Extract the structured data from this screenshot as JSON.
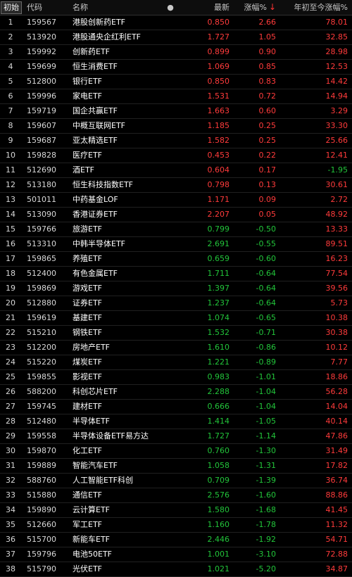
{
  "header": {
    "reset_label": "初始",
    "code_label": "代码",
    "name_label": "名称",
    "dot_icon": "●",
    "price_label": "最新",
    "change_label": "涨幅%",
    "sort_icon": "↓",
    "ytd_label": "年初至今涨幅%"
  },
  "colors": {
    "up": "#ff3b3b",
    "down": "#22c53a",
    "background": "#000000"
  },
  "rows": [
    {
      "idx": "1",
      "code": "159567",
      "name": "港股创新药ETF",
      "price": "0.850",
      "chg": "2.66",
      "ytd": "78.01"
    },
    {
      "idx": "2",
      "code": "513920",
      "name": "港股通央企红利ETF",
      "price": "1.727",
      "chg": "1.05",
      "ytd": "32.85"
    },
    {
      "idx": "3",
      "code": "159992",
      "name": "创新药ETF",
      "price": "0.899",
      "chg": "0.90",
      "ytd": "28.98"
    },
    {
      "idx": "4",
      "code": "159699",
      "name": "恒生消费ETF",
      "price": "1.069",
      "chg": "0.85",
      "ytd": "12.53"
    },
    {
      "idx": "5",
      "code": "512800",
      "name": "银行ETF",
      "price": "0.850",
      "chg": "0.83",
      "ytd": "14.42"
    },
    {
      "idx": "6",
      "code": "159996",
      "name": "家电ETF",
      "price": "1.531",
      "chg": "0.72",
      "ytd": "14.94"
    },
    {
      "idx": "7",
      "code": "159719",
      "name": "国企共赢ETF",
      "price": "1.663",
      "chg": "0.60",
      "ytd": "3.29"
    },
    {
      "idx": "8",
      "code": "159607",
      "name": "中概互联网ETF",
      "price": "1.185",
      "chg": "0.25",
      "ytd": "33.30"
    },
    {
      "idx": "9",
      "code": "159687",
      "name": "亚太精选ETF",
      "price": "1.582",
      "chg": "0.25",
      "ytd": "25.66"
    },
    {
      "idx": "10",
      "code": "159828",
      "name": "医疗ETF",
      "price": "0.453",
      "chg": "0.22",
      "ytd": "12.41"
    },
    {
      "idx": "11",
      "code": "512690",
      "name": "酒ETF",
      "price": "0.604",
      "chg": "0.17",
      "ytd": "-1.95"
    },
    {
      "idx": "12",
      "code": "513180",
      "name": "恒生科技指数ETF",
      "price": "0.798",
      "chg": "0.13",
      "ytd": "30.61"
    },
    {
      "idx": "13",
      "code": "501011",
      "name": "中药基金LOF",
      "price": "1.171",
      "chg": "0.09",
      "ytd": "2.72"
    },
    {
      "idx": "14",
      "code": "513090",
      "name": "香港证券ETF",
      "price": "2.207",
      "chg": "0.05",
      "ytd": "48.92"
    },
    {
      "idx": "15",
      "code": "159766",
      "name": "旅游ETF",
      "price": "0.799",
      "chg": "-0.50",
      "ytd": "13.33"
    },
    {
      "idx": "16",
      "code": "513310",
      "name": "中韩半导体ETF",
      "price": "2.691",
      "chg": "-0.55",
      "ytd": "89.51"
    },
    {
      "idx": "17",
      "code": "159865",
      "name": "养殖ETF",
      "price": "0.659",
      "chg": "-0.60",
      "ytd": "16.23"
    },
    {
      "idx": "18",
      "code": "512400",
      "name": "有色金属ETF",
      "price": "1.711",
      "chg": "-0.64",
      "ytd": "77.54"
    },
    {
      "idx": "19",
      "code": "159869",
      "name": "游戏ETF",
      "price": "1.397",
      "chg": "-0.64",
      "ytd": "39.56"
    },
    {
      "idx": "20",
      "code": "512880",
      "name": "证券ETF",
      "price": "1.237",
      "chg": "-0.64",
      "ytd": "5.73"
    },
    {
      "idx": "21",
      "code": "159619",
      "name": "基建ETF",
      "price": "1.074",
      "chg": "-0.65",
      "ytd": "10.38"
    },
    {
      "idx": "22",
      "code": "515210",
      "name": "钢铁ETF",
      "price": "1.532",
      "chg": "-0.71",
      "ytd": "30.38"
    },
    {
      "idx": "23",
      "code": "512200",
      "name": "房地产ETF",
      "price": "1.610",
      "chg": "-0.86",
      "ytd": "10.12"
    },
    {
      "idx": "24",
      "code": "515220",
      "name": "煤炭ETF",
      "price": "1.221",
      "chg": "-0.89",
      "ytd": "7.77"
    },
    {
      "idx": "25",
      "code": "159855",
      "name": "影视ETF",
      "price": "0.983",
      "chg": "-1.01",
      "ytd": "18.86"
    },
    {
      "idx": "26",
      "code": "588200",
      "name": "科创芯片ETF",
      "price": "2.288",
      "chg": "-1.04",
      "ytd": "56.28"
    },
    {
      "idx": "27",
      "code": "159745",
      "name": "建材ETF",
      "price": "0.666",
      "chg": "-1.04",
      "ytd": "14.04"
    },
    {
      "idx": "28",
      "code": "512480",
      "name": "半导体ETF",
      "price": "1.414",
      "chg": "-1.05",
      "ytd": "40.14"
    },
    {
      "idx": "29",
      "code": "159558",
      "name": "半导体设备ETF易方达",
      "price": "1.727",
      "chg": "-1.14",
      "ytd": "47.86"
    },
    {
      "idx": "30",
      "code": "159870",
      "name": "化工ETF",
      "price": "0.760",
      "chg": "-1.30",
      "ytd": "31.49"
    },
    {
      "idx": "31",
      "code": "159889",
      "name": "智能汽车ETF",
      "price": "1.058",
      "chg": "-1.31",
      "ytd": "17.82"
    },
    {
      "idx": "32",
      "code": "588760",
      "name": "人工智能ETF科创",
      "price": "0.709",
      "chg": "-1.39",
      "ytd": "36.74"
    },
    {
      "idx": "33",
      "code": "515880",
      "name": "通信ETF",
      "price": "2.576",
      "chg": "-1.60",
      "ytd": "88.86"
    },
    {
      "idx": "34",
      "code": "159890",
      "name": "云计算ETF",
      "price": "1.580",
      "chg": "-1.68",
      "ytd": "41.45"
    },
    {
      "idx": "35",
      "code": "512660",
      "name": "军工ETF",
      "price": "1.160",
      "chg": "-1.78",
      "ytd": "11.32"
    },
    {
      "idx": "36",
      "code": "515700",
      "name": "新能车ETF",
      "price": "2.446",
      "chg": "-1.92",
      "ytd": "54.71"
    },
    {
      "idx": "37",
      "code": "159796",
      "name": "电池50ETF",
      "price": "1.001",
      "chg": "-3.10",
      "ytd": "72.88"
    },
    {
      "idx": "38",
      "code": "515790",
      "name": "光伏ETF",
      "price": "1.021",
      "chg": "-5.20",
      "ytd": "34.87"
    }
  ]
}
